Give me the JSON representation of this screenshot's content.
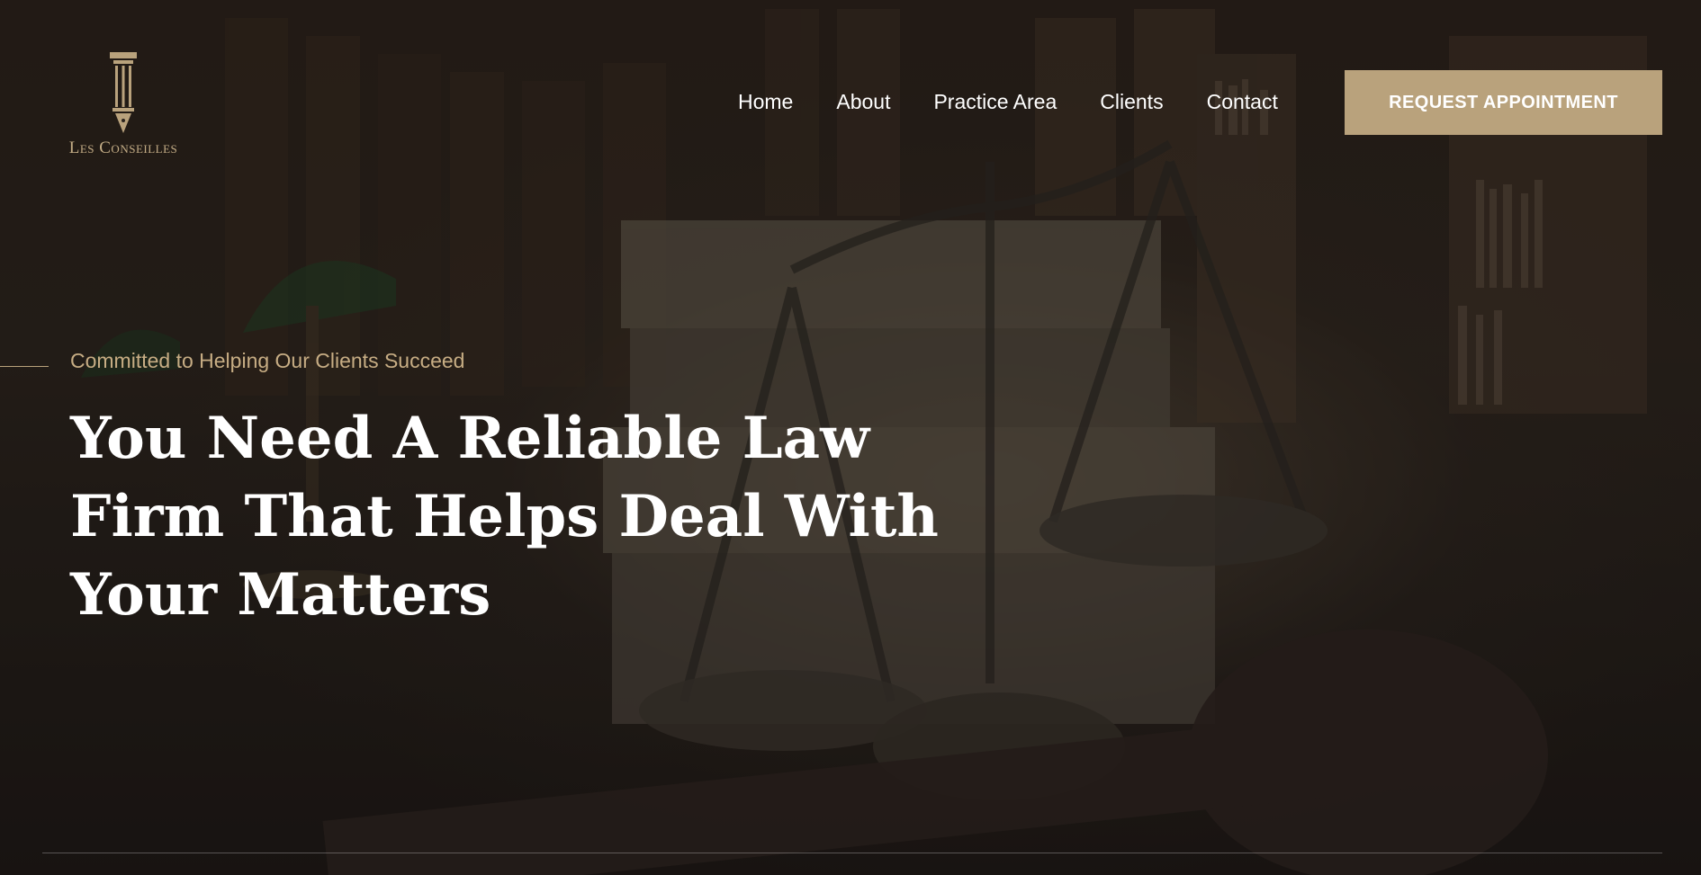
{
  "brand": {
    "name": "Les Conseilles",
    "logo_icon": "pen-column-icon",
    "accent_color": "#b9a27c"
  },
  "nav": {
    "items": [
      {
        "label": "Home"
      },
      {
        "label": "About"
      },
      {
        "label": "Practice Area"
      },
      {
        "label": "Clients"
      },
      {
        "label": "Contact"
      }
    ],
    "cta_label": "REQUEST APPOINTMENT"
  },
  "hero": {
    "tagline": "Committed to Helping Our Clients Succeed",
    "headline": "You Need A Reliable Law Firm That Helps Deal With Your Matters",
    "background": "scales-of-justice-library-image"
  }
}
